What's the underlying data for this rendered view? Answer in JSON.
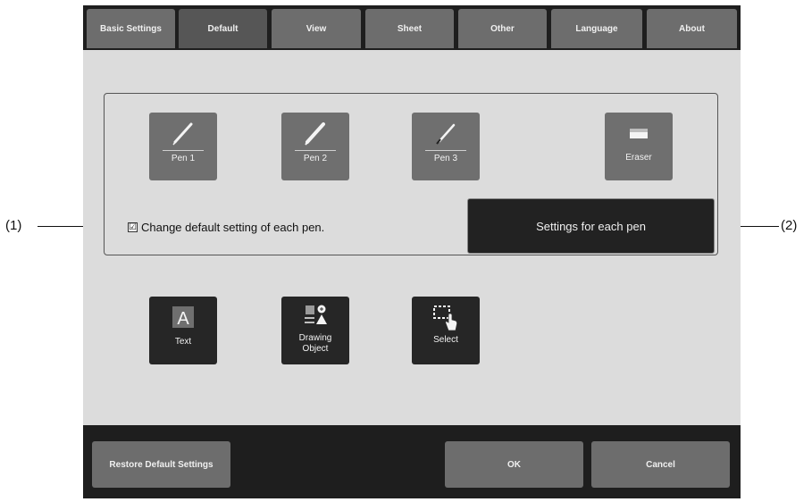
{
  "tabs": [
    {
      "label": "Basic Settings"
    },
    {
      "label": "Default"
    },
    {
      "label": "View"
    },
    {
      "label": "Sheet"
    },
    {
      "label": "Other"
    },
    {
      "label": "Language"
    },
    {
      "label": "About"
    }
  ],
  "active_tab": "Default",
  "pens": [
    {
      "label": "Pen 1",
      "icon": "pen-icon"
    },
    {
      "label": "Pen 2",
      "icon": "pen-icon"
    },
    {
      "label": "Pen 3",
      "icon": "pen-icon"
    },
    {
      "label": "Eraser",
      "icon": "eraser-icon"
    }
  ],
  "change_default": {
    "checked": true,
    "check_mark": "☑",
    "label": "Change default setting of each pen."
  },
  "settings_button_label": "Settings for each pen",
  "tools": [
    {
      "label": "Text",
      "icon": "text-icon"
    },
    {
      "label": "Drawing Object",
      "icon": "drawing-object-icon"
    },
    {
      "label": "Select",
      "icon": "select-icon"
    }
  ],
  "text_icon_glyph": "A",
  "bottom": {
    "restore_label": "Restore Default Settings",
    "ok_label": "OK",
    "cancel_label": "Cancel"
  },
  "callouts": {
    "left": "(1)",
    "right": "(2)"
  },
  "colors": {
    "tab": "#6d6d6d",
    "tab_active": "#565656",
    "content_bg": "#dcdcdc",
    "frame_bg": "#1e1e1e"
  }
}
